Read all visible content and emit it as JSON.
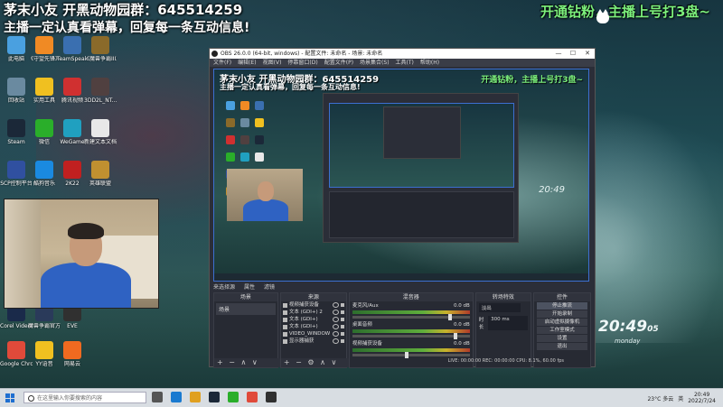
{
  "stream_overlay": {
    "line1": "茅末小友 开黑动物园群：645514259",
    "line2": "主播一定认真看弹幕，回复每一条互动信息!",
    "right_banner": "开通钻粉，主播上号打3盘~"
  },
  "desktop_icons": [
    {
      "label": "此电脑",
      "color": "#4aa0e0"
    },
    {
      "label": "《守望先锋》",
      "color": "#f08a24"
    },
    {
      "label": "TeamSpeak",
      "color": "#3a6fb0"
    },
    {
      "label": "《魔兽争霸III》",
      "color": "#8a6a2a"
    },
    {
      "label": "回收站",
      "color": "#6a8aa0"
    },
    {
      "label": "实用工具",
      "color": "#f0c020"
    },
    {
      "label": "腾讯视频",
      "color": "#d03030"
    },
    {
      "label": "3DD2L_NT...",
      "color": "#504040"
    },
    {
      "label": "Steam",
      "color": "#1b2838"
    },
    {
      "label": "微信",
      "color": "#2aae2a"
    },
    {
      "label": "WeGame",
      "color": "#20a0c0"
    },
    {
      "label": "新建文本文档",
      "color": "#e8e8e8"
    },
    {
      "label": "SCP控制平台",
      "color": "#3050a0"
    },
    {
      "label": "酷狗音乐",
      "color": "#1a8ae0"
    },
    {
      "label": "2K22",
      "color": "#c02020"
    },
    {
      "label": "英雄联盟",
      "color": "#c09030"
    },
    {
      "label": "Corel VideoStudi...",
      "color": "#1a2a4a"
    },
    {
      "label": "魔兽争霸官方对战平台",
      "color": "#2a3a5a"
    },
    {
      "label": "EVE",
      "color": "#303030"
    },
    {
      "label": "Google Chrome",
      "color": "#e04a3a"
    },
    {
      "label": "YY语音",
      "color": "#f0c020"
    },
    {
      "label": "网易云",
      "color": "#f06a20"
    }
  ],
  "obs": {
    "title": "OBS 26.0.0 (64-bit, windows) - 配置文件: 未命名 - 场景: 未命名",
    "window_controls": [
      "—",
      "☐",
      "✕"
    ],
    "menu": [
      "文件(F)",
      "编辑(E)",
      "视图(V)",
      "停靠窗口(D)",
      "配置文件(P)",
      "场景集合(S)",
      "工具(T)",
      "帮助(H)"
    ],
    "preview": {
      "line1": "茅末小友 开黑动物园群：645514259",
      "line2": "主播一定认真看弹幕，回复每一条互动信息!",
      "right_banner": "开通钻粉，主播上号打3盘~",
      "clock": "20:49"
    },
    "status_labels": {
      "source": "来选择源",
      "props": "属性",
      "filters": "滤镜"
    },
    "scenes": {
      "title": "场景",
      "items": [
        "场景"
      ],
      "footer": "+ − ∧ ∨"
    },
    "sources": {
      "title": "来源",
      "items": [
        "视频捕获设备",
        "文本 (GDI+) 2",
        "文本 (GDI+)",
        "文本 (GDI+)",
        "VIDEO_WINDOW 1",
        "显示器捕获"
      ],
      "footer": "+ − ⚙ ∧ ∨"
    },
    "mixer": {
      "title": "混音器",
      "channels": [
        {
          "name": "麦克风/Aux",
          "db": "0.0 dB",
          "level": 0.82
        },
        {
          "name": "桌面音频",
          "db": "0.0 dB",
          "level": 0.86
        },
        {
          "name": "视频捕获设备",
          "db": "0.0 dB",
          "level": 0.45
        }
      ]
    },
    "transitions": {
      "title": "转场特效",
      "type": "淡出",
      "duration_label": "时长",
      "duration": "300 ms"
    },
    "controls": {
      "title": "控件",
      "buttons": [
        "停止推流",
        "开始录制",
        "启动虚拟摄像机",
        "工作室模式",
        "设置",
        "退出"
      ]
    },
    "statusbar": "LIVE: 00:00:00  REC: 00:00:00  CPU: 8.1%, 60.00 fps"
  },
  "wallpaper": {
    "clock": "20:49",
    "seconds": "05",
    "sub": "monday"
  },
  "taskbar": {
    "search_placeholder": "在这里输入你要搜索的内容",
    "weather": "23°C 多云",
    "time": "20:49",
    "date": "2022/7/24",
    "lang": "英"
  }
}
